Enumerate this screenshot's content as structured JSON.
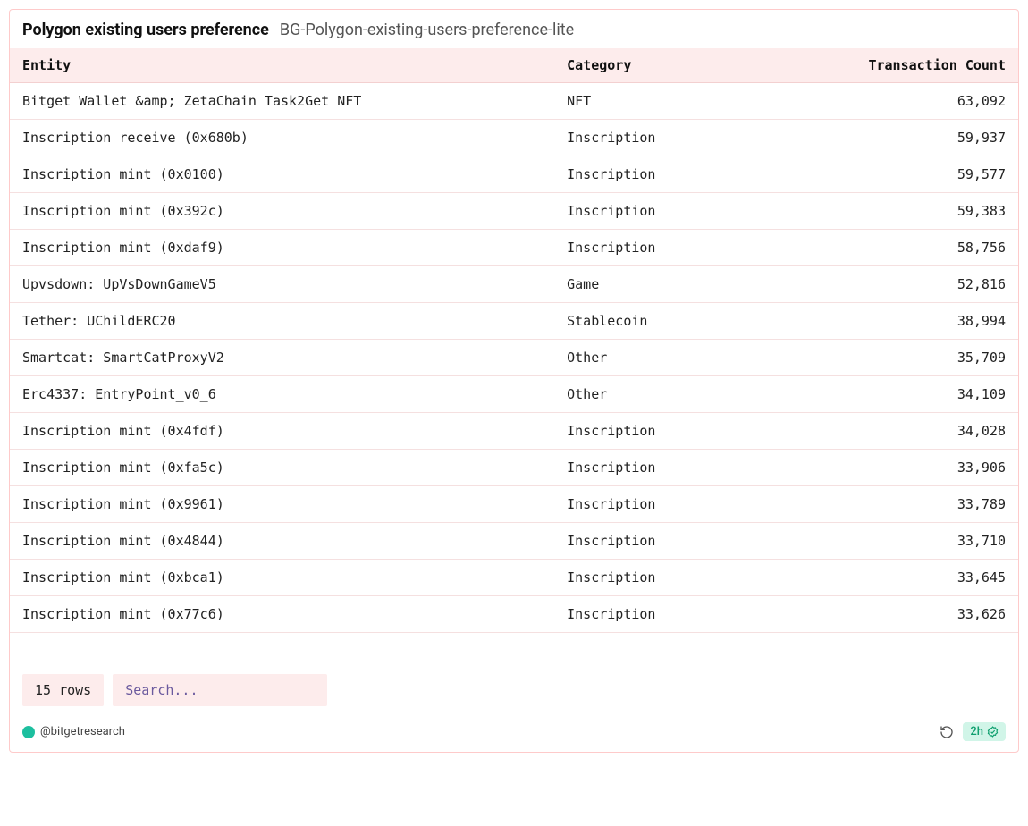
{
  "header": {
    "title": "Polygon existing users preference",
    "subtitle": "BG-Polygon-existing-users-preference-lite"
  },
  "columns": {
    "entity": "Entity",
    "category": "Category",
    "count": "Transaction Count"
  },
  "rows": [
    {
      "entity": "Bitget Wallet &amp; ZetaChain Task2Get NFT",
      "category": "NFT",
      "count": "63,092"
    },
    {
      "entity": "Inscription receive (0x680b)",
      "category": "Inscription",
      "count": "59,937"
    },
    {
      "entity": "Inscription mint (0x0100)",
      "category": "Inscription",
      "count": "59,577"
    },
    {
      "entity": "Inscription mint (0x392c)",
      "category": "Inscription",
      "count": "59,383"
    },
    {
      "entity": "Inscription mint (0xdaf9)",
      "category": "Inscription",
      "count": "58,756"
    },
    {
      "entity": "Upvsdown: UpVsDownGameV5",
      "category": "Game",
      "count": "52,816"
    },
    {
      "entity": "Tether: UChildERC20",
      "category": "Stablecoin",
      "count": "38,994"
    },
    {
      "entity": "Smartcat: SmartCatProxyV2",
      "category": "Other",
      "count": "35,709"
    },
    {
      "entity": "Erc4337: EntryPoint_v0_6",
      "category": "Other",
      "count": "34,109"
    },
    {
      "entity": "Inscription mint (0x4fdf)",
      "category": "Inscription",
      "count": "34,028"
    },
    {
      "entity": "Inscription mint (0xfa5c)",
      "category": "Inscription",
      "count": "33,906"
    },
    {
      "entity": "Inscription mint (0x9961)",
      "category": "Inscription",
      "count": "33,789"
    },
    {
      "entity": "Inscription mint (0x4844)",
      "category": "Inscription",
      "count": "33,710"
    },
    {
      "entity": "Inscription mint (0xbca1)",
      "category": "Inscription",
      "count": "33,645"
    },
    {
      "entity": "Inscription mint (0x77c6)",
      "category": "Inscription",
      "count": "33,626"
    }
  ],
  "footer": {
    "row_count_label": "15 rows",
    "search_placeholder": "Search...",
    "handle": "@bitgetresearch",
    "time_badge": "2h"
  },
  "chart_data": {
    "type": "table",
    "title": "Polygon existing users preference",
    "columns": [
      "Entity",
      "Category",
      "Transaction Count"
    ],
    "data": [
      [
        "Bitget Wallet & ZetaChain Task2Get NFT",
        "NFT",
        63092
      ],
      [
        "Inscription receive (0x680b)",
        "Inscription",
        59937
      ],
      [
        "Inscription mint (0x0100)",
        "Inscription",
        59577
      ],
      [
        "Inscription mint (0x392c)",
        "Inscription",
        59383
      ],
      [
        "Inscription mint (0xdaf9)",
        "Inscription",
        58756
      ],
      [
        "Upvsdown: UpVsDownGameV5",
        "Game",
        52816
      ],
      [
        "Tether: UChildERC20",
        "Stablecoin",
        38994
      ],
      [
        "Smartcat: SmartCatProxyV2",
        "Other",
        35709
      ],
      [
        "Erc4337: EntryPoint_v0_6",
        "Other",
        34109
      ],
      [
        "Inscription mint (0x4fdf)",
        "Inscription",
        34028
      ],
      [
        "Inscription mint (0xfa5c)",
        "Inscription",
        33906
      ],
      [
        "Inscription mint (0x9961)",
        "Inscription",
        33789
      ],
      [
        "Inscription mint (0x4844)",
        "Inscription",
        33710
      ],
      [
        "Inscription mint (0xbca1)",
        "Inscription",
        33645
      ],
      [
        "Inscription mint (0x77c6)",
        "Inscription",
        33626
      ]
    ]
  }
}
